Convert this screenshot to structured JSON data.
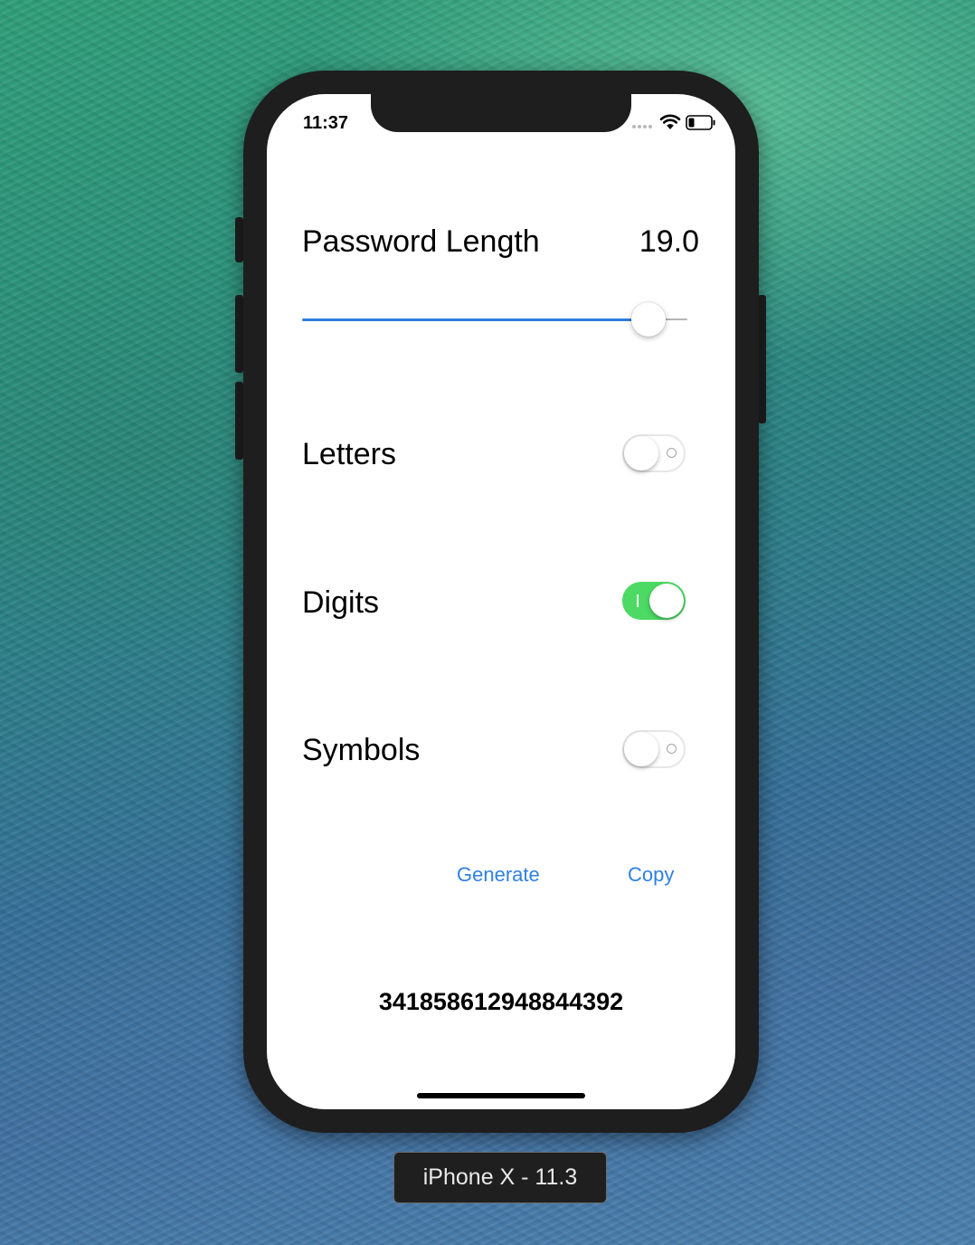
{
  "status_bar": {
    "time": "11:37",
    "signal_icon": "cellular-dots-icon",
    "wifi_icon": "wifi-icon",
    "battery_icon": "battery-icon"
  },
  "app": {
    "password_length": {
      "label": "Password Length",
      "value_text": "19.0",
      "slider_fraction": 0.9
    },
    "toggles": [
      {
        "label": "Letters",
        "on": false
      },
      {
        "label": "Digits",
        "on": true
      },
      {
        "label": "Symbols",
        "on": false
      }
    ],
    "buttons": {
      "generate": "Generate",
      "copy": "Copy"
    },
    "output": "341858612948844392"
  },
  "simulator": {
    "device_label": "iPhone X - 11.3"
  },
  "colors": {
    "accent": "#2f80e4",
    "switch_on": "#4cd964"
  }
}
